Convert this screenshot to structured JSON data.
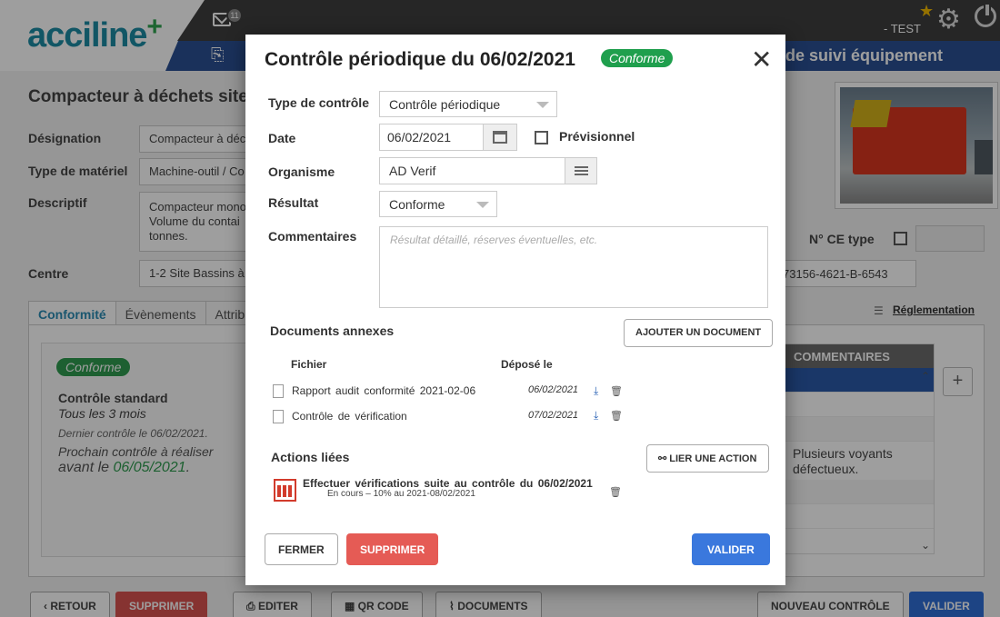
{
  "header": {
    "logo_text": "acciline",
    "logo_plus": "+",
    "mail_count": "11",
    "user": "- TEST",
    "page_heading": "de suivi équipement"
  },
  "page": {
    "title": "Compacteur à déchets site B",
    "designation_label": "Désignation",
    "designation_value": "Compacteur à déc",
    "type_label": "Type de matériel",
    "type_value": "Machine-outil / Co",
    "desc_label": "Descriptif",
    "desc_value": "Compacteur mono Volume du contai tonnes.",
    "centre_label": "Centre",
    "centre_value": "1-2 Site Bassins à",
    "ce_label": "N° CE type",
    "serial": "73156-4621-B-6543",
    "reglementation": "Réglementation",
    "tabs": [
      "Conformité",
      "Évènements",
      "Attribu"
    ],
    "card": {
      "badge": "Conforme",
      "title": "Contrôle standard",
      "frequency": "Tous les 3 mois",
      "last": "Dernier contrôle le 06/02/2021.",
      "next_line1": "Prochain contrôle à réaliser",
      "next_prefix": "avant le ",
      "next_date": "06/05/2021",
      "next_suffix": "."
    },
    "comments_header": "COMMENTAIRES",
    "comment_text": "Plusieurs voyants défectueux."
  },
  "bottom_bar": {
    "retour": "RETOUR",
    "supprimer": "SUPPRIMER",
    "editer": "EDITER",
    "qrcode": "QR CODE",
    "documents": "DOCUMENTS",
    "nouveau": "NOUVEAU CONTRÔLE",
    "valider": "VALIDER"
  },
  "modal": {
    "title": "Contrôle périodique du 06/02/2021",
    "badge": "Conforme",
    "type_label": "Type de contrôle",
    "type_value": "Contrôle périodique",
    "date_label": "Date",
    "date_value": "06/02/2021",
    "previsionnel_label": "Prévisionnel",
    "organisme_label": "Organisme",
    "organisme_value": "AD Verif",
    "resultat_label": "Résultat",
    "resultat_value": "Conforme",
    "commentaires_label": "Commentaires",
    "commentaires_placeholder": "Résultat détaillé, réserves éventuelles, etc.",
    "documents_title": "Documents annexes",
    "add_document": "AJOUTER UN DOCUMENT",
    "col_fichier": "Fichier",
    "col_depose": "Déposé le",
    "documents": [
      {
        "name": "Rapport audit conformité 2021-02-06",
        "date": "06/02/2021"
      },
      {
        "name": "Contrôle de vérification",
        "date": "07/02/2021"
      }
    ],
    "actions_title": "Actions liées",
    "link_action": "LIER UNE ACTION",
    "action_title": "Effectuer vérifications suite au contrôle du 06/02/2021",
    "action_status": "En cours – 10% au 2021-08/02/2021",
    "fermer": "FERMER",
    "supprimer": "SUPPRIMER",
    "valider": "VALIDER"
  }
}
